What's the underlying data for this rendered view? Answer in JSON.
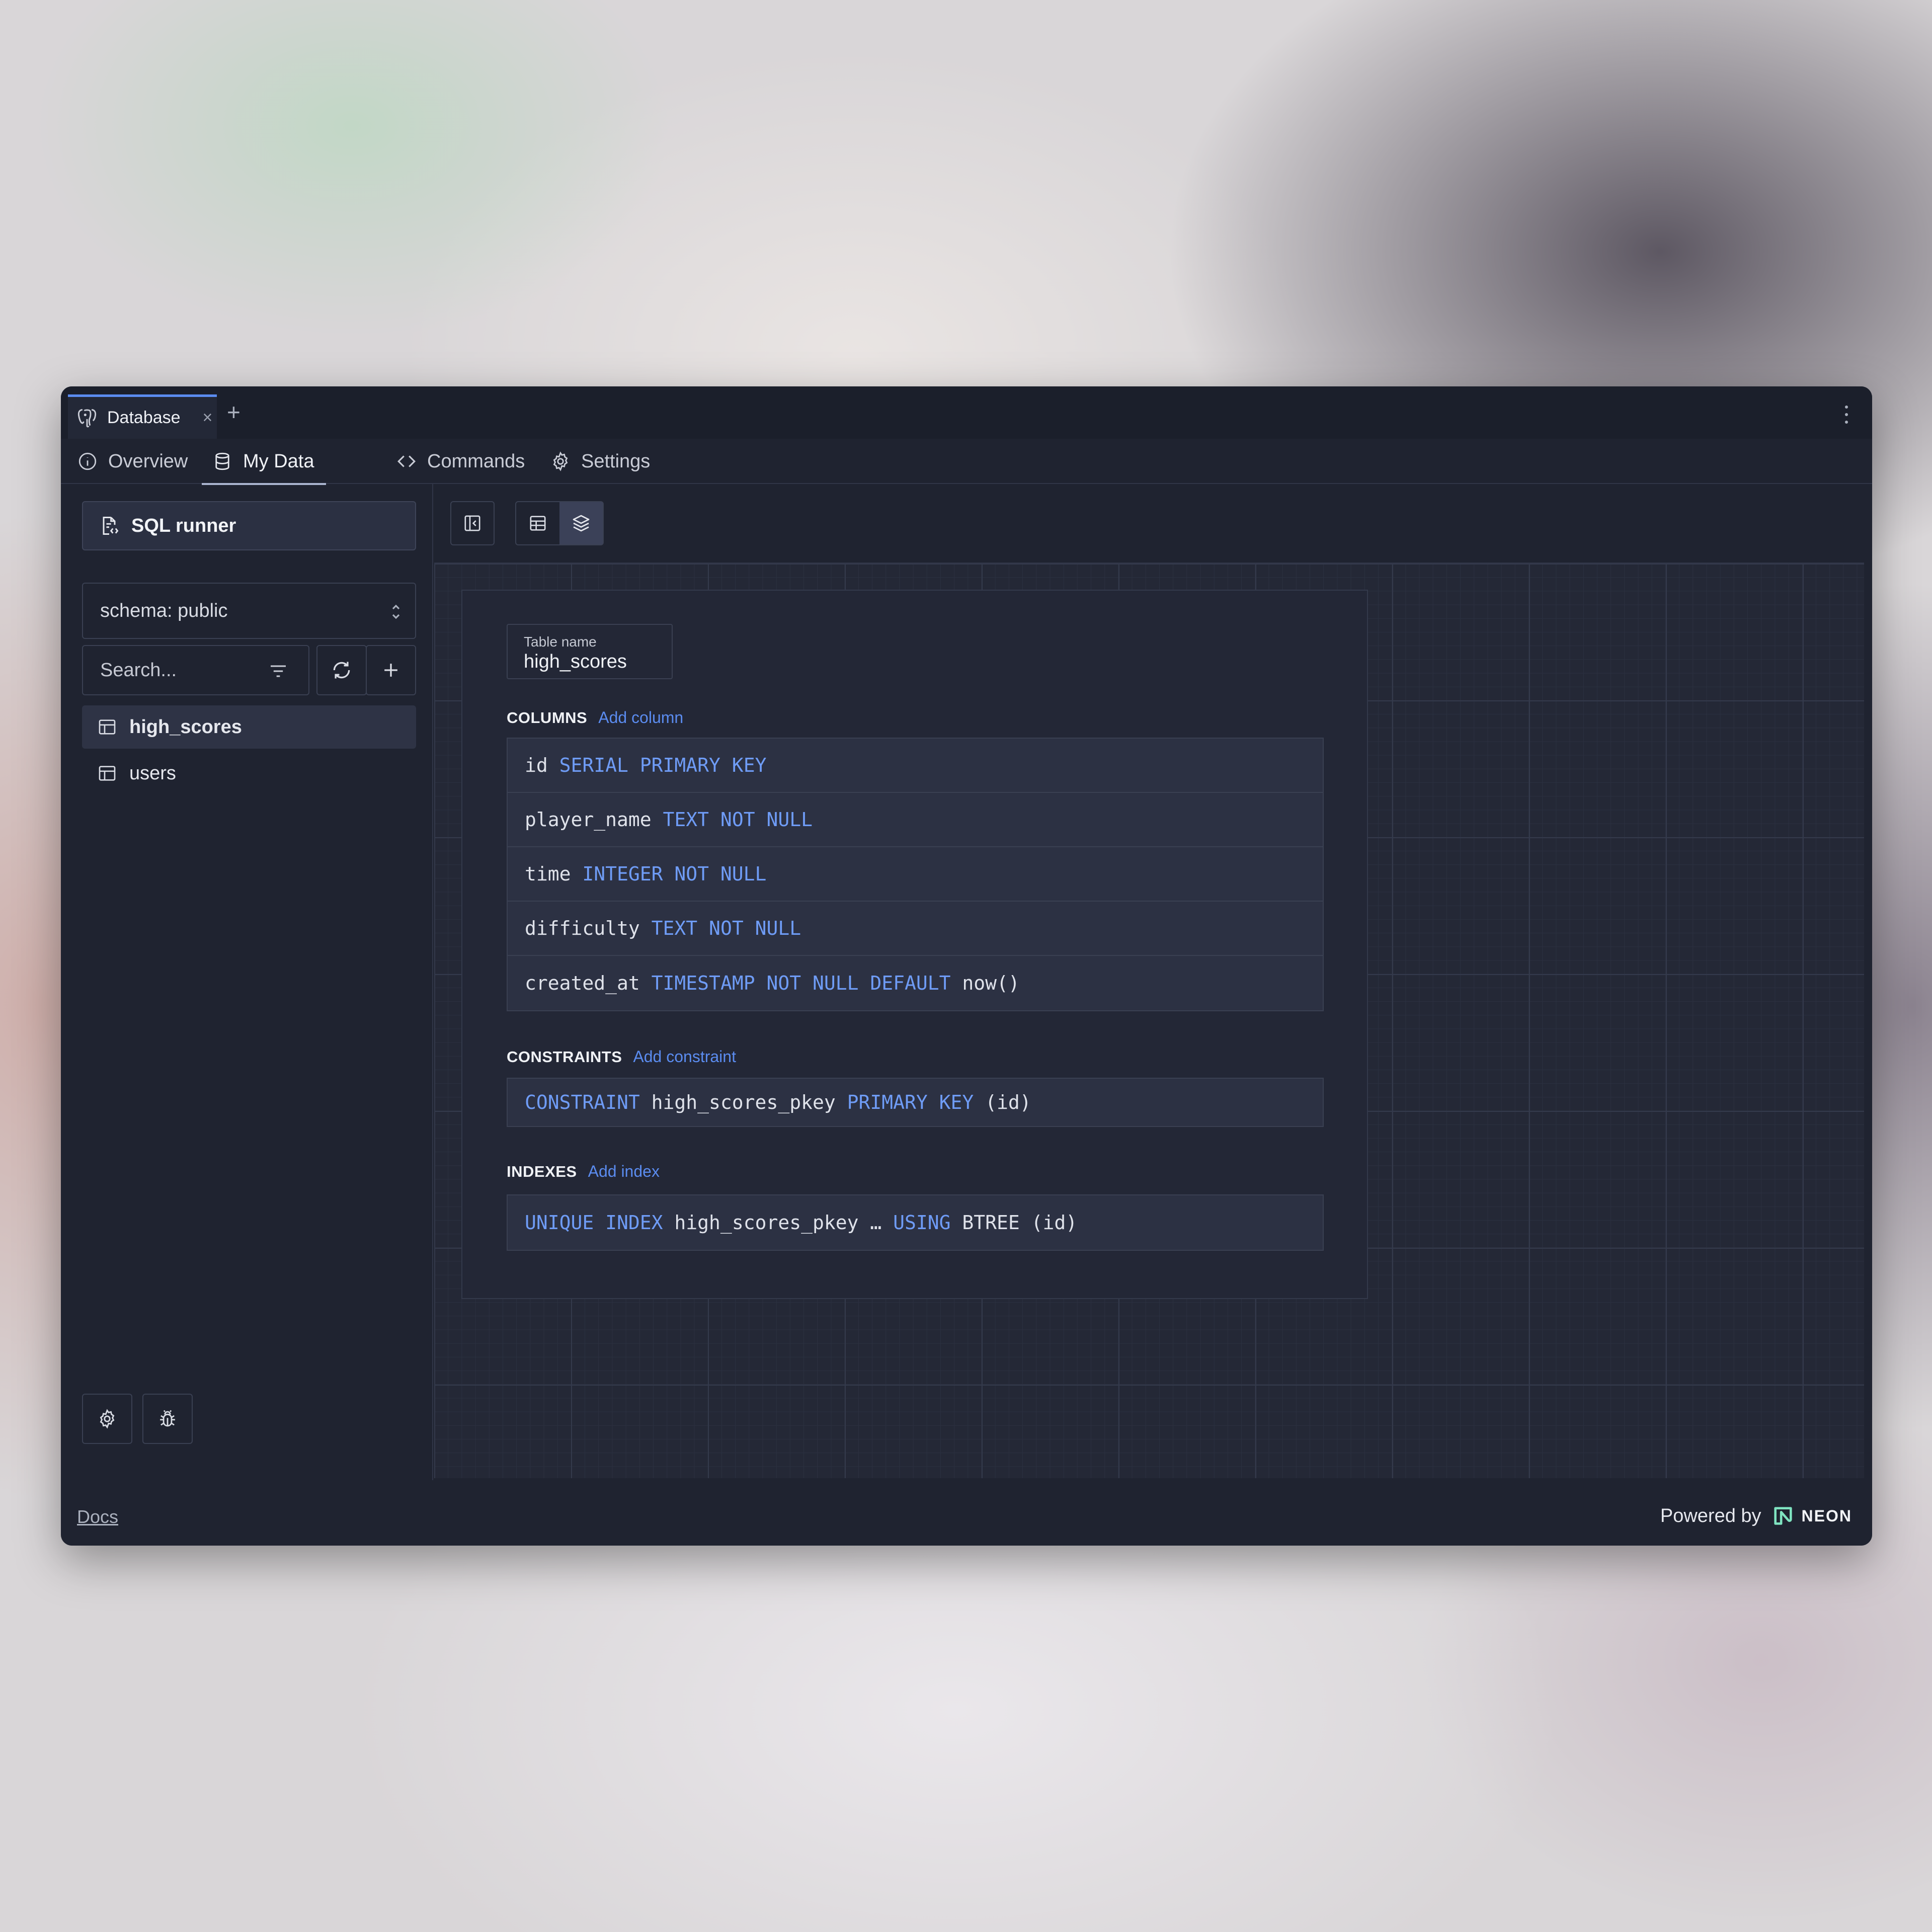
{
  "window": {
    "tab_title": "Database",
    "tab_close": "×",
    "tab_add": "+"
  },
  "nav": {
    "items": [
      {
        "label": "Overview",
        "icon": "info-icon"
      },
      {
        "label": "My Data",
        "icon": "database-icon",
        "active": true
      },
      {
        "label": "Commands",
        "icon": "code-icon"
      },
      {
        "label": "Settings",
        "icon": "gear-icon"
      }
    ]
  },
  "sidebar": {
    "sql_runner_label": "SQL runner",
    "schema_label": "schema: public",
    "search_placeholder": "Search...",
    "tables": [
      {
        "name": "high_scores",
        "selected": true
      },
      {
        "name": "users",
        "selected": false
      }
    ]
  },
  "table": {
    "name_label": "Table name",
    "name_value": "high_scores",
    "columns_title": "COLUMNS",
    "add_column": "Add column",
    "columns": [
      [
        {
          "t": "id "
        },
        {
          "k": "SERIAL PRIMARY KEY"
        }
      ],
      [
        {
          "t": "player_name "
        },
        {
          "k": "TEXT NOT NULL"
        }
      ],
      [
        {
          "t": "time "
        },
        {
          "k": "INTEGER NOT NULL"
        }
      ],
      [
        {
          "t": "difficulty "
        },
        {
          "k": "TEXT NOT NULL"
        }
      ],
      [
        {
          "t": "created_at "
        },
        {
          "k": "TIMESTAMP NOT NULL DEFAULT"
        },
        {
          "t": " now()"
        }
      ]
    ],
    "constraints_title": "CONSTRAINTS",
    "add_constraint": "Add constraint",
    "constraints": [
      [
        {
          "k": "CONSTRAINT"
        },
        {
          "t": " high_scores_pkey "
        },
        {
          "k": "PRIMARY KEY"
        },
        {
          "t": " (id)"
        }
      ]
    ],
    "indexes_title": "INDEXES",
    "add_index": "Add index",
    "indexes": [
      [
        {
          "k": "UNIQUE INDEX"
        },
        {
          "t": " high_scores_pkey … "
        },
        {
          "k": "USING"
        },
        {
          "t": " BTREE (id)"
        }
      ]
    ]
  },
  "footer": {
    "docs": "Docs",
    "powered_by": "Powered by",
    "brand": "NEON"
  },
  "colors": {
    "accent": "#5b8cf0",
    "keyword": "#6f9cf6",
    "background": "#1f2330"
  }
}
